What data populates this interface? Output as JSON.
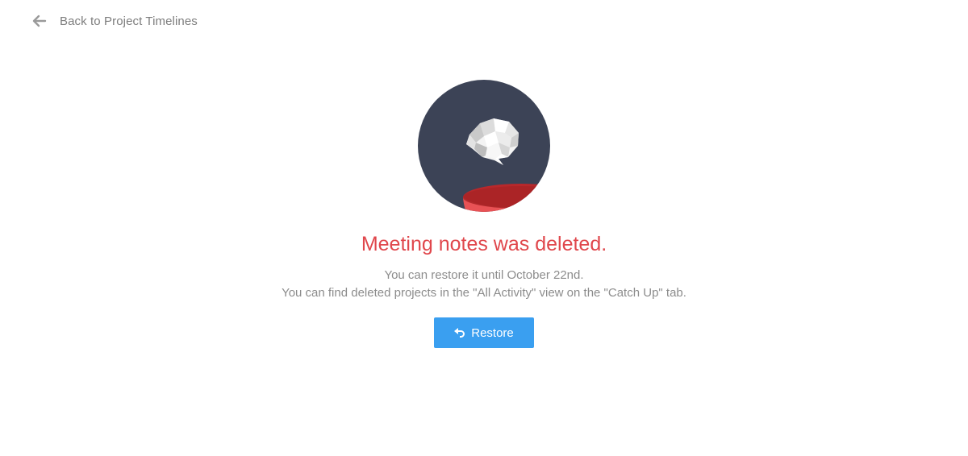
{
  "nav": {
    "back_label": "Back to Project Timelines",
    "back_icon": "arrow-left-icon"
  },
  "illustration": {
    "icon": "crumpled-paper-trash-icon",
    "colors": {
      "circle": "#3c4356",
      "bin": "#d3373a",
      "bin_rim": "#e85255",
      "paper": "#ffffff"
    }
  },
  "message": {
    "title": "Meeting notes was deleted.",
    "line1": "You can restore it until October 22nd.",
    "line2": "You can find deleted projects in the \"All Activity\" view on the \"Catch Up\" tab."
  },
  "restore": {
    "label": "Restore",
    "icon": "undo-arrow-icon",
    "color": "#3a9ff0"
  },
  "theme": {
    "title_color": "#e0474c",
    "text_color": "#8c8c8c"
  }
}
